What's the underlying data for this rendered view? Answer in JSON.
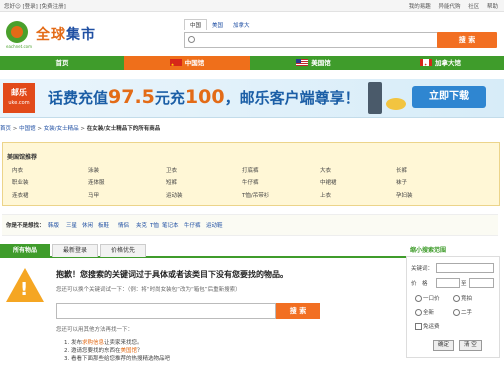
{
  "topbar": {
    "greeting": "您好☺ [登录] [免费注册]",
    "links": [
      "我的易趣",
      "异能代购",
      "社区",
      "帮助"
    ]
  },
  "header": {
    "logo_text_1": "全球",
    "logo_text_2": "集市",
    "logo_sub": "eachnet.com",
    "search_tabs": [
      "中国",
      "美国",
      "加拿大"
    ],
    "search_placeholder": "",
    "search_button": "搜 索"
  },
  "nav": {
    "items": [
      {
        "label": "首页",
        "flag": ""
      },
      {
        "label": "中国馆",
        "flag": "cn"
      },
      {
        "label": "美国馆",
        "flag": "us"
      },
      {
        "label": "加拿大馆",
        "flag": "ca"
      }
    ]
  },
  "banner": {
    "logo_title": "邮乐",
    "logo_sub": "uke.com",
    "text_1": "话费充值",
    "amount_1": "97.5",
    "text_2": "元充",
    "amount_2": "100",
    "text_3": "，邮乐客户端尊享！",
    "download": "立即下载"
  },
  "breadcrumb": {
    "home": "首页",
    "china": "中国馆",
    "category": "女装/女士精品",
    "current": "在女装/女士精品下的所有商品",
    "sep": " > "
  },
  "recommend": {
    "title": "美国馆推荐",
    "rows": [
      [
        "内衣",
        "泳装",
        "卫衣",
        "打底裤",
        "大衣",
        "长裤"
      ],
      [
        "职业装",
        "连体服",
        "短裤",
        "牛仔裤",
        "中裙裙",
        "袜子"
      ],
      [
        "连衣裙",
        "马甲",
        "运动装",
        "T恤/吊带衫",
        "上衣",
        "孕妇装"
      ]
    ]
  },
  "hot": {
    "label": "你是不是想找：",
    "words": [
      "韩版",
      "三星",
      "休闲",
      "板鞋",
      "情侣",
      "夹克",
      "T恤",
      "笔记本",
      "牛仔裤",
      "运动鞋"
    ]
  },
  "tabs": [
    "所有物品",
    "最新登录",
    "价格优先"
  ],
  "empty": {
    "headline": "抱歉！您搜索的关键词过于具体或者该类目下没有您要找的物品。",
    "sub": "您还可以换个关键词试一下：（例：将“时尚女装包”改为“箱包”后重新搜索）",
    "search_button": "搜 索",
    "alt_intro": "您还可以用其他方法再找一下：",
    "tips": [
      {
        "pre": "1. 发布",
        "link": "求购信息",
        "post": "让卖家来找您。"
      },
      {
        "pre": "2. 邀请您要找的东西在",
        "link": "美国馆",
        "post": "？"
      },
      {
        "pre": "3. 看看下面那些给您推荐的热搜精选物品吧",
        "link": "",
        "post": ""
      }
    ]
  },
  "refine": {
    "title": "缩小搜索范围",
    "keyword_label": "关键词：",
    "price_label": "价　格",
    "price_sep": "至",
    "options": [
      "一口价",
      "竞拍",
      "全新",
      "二手"
    ],
    "free_shipping": "免运费",
    "confirm": "确定",
    "reset": "清 空"
  }
}
